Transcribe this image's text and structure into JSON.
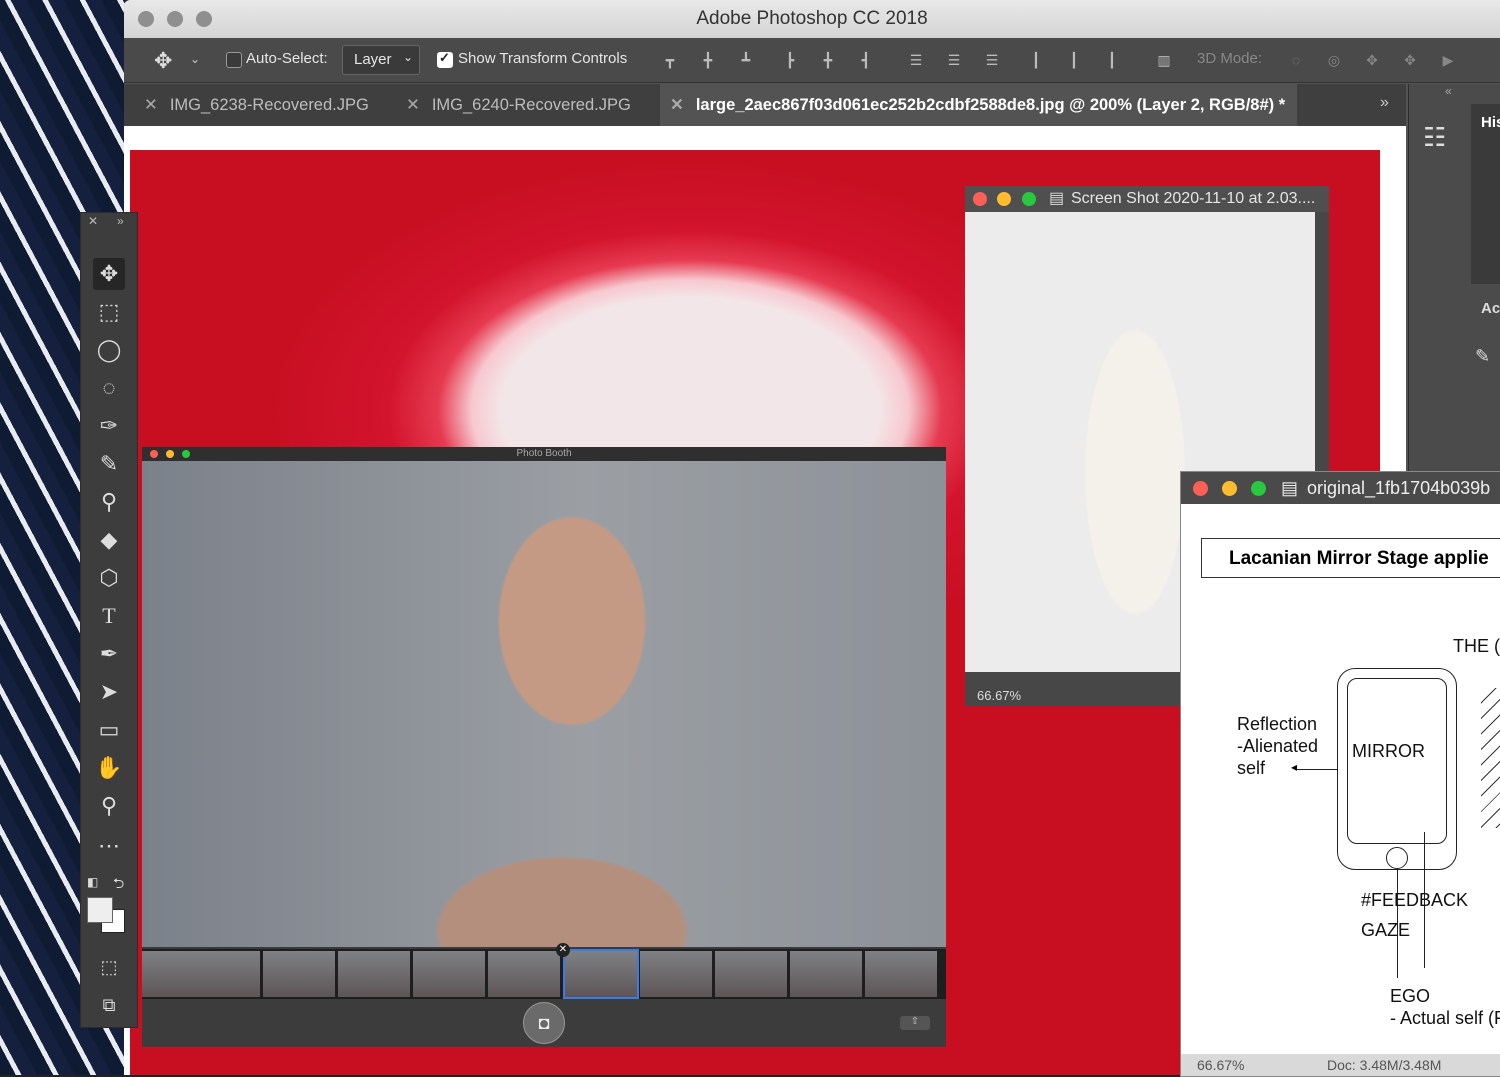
{
  "app": {
    "title": "Adobe Photoshop CC 2018"
  },
  "options_bar": {
    "auto_select_label": "Auto-Select:",
    "auto_select_value": "Layer",
    "show_transform_label": "Show Transform Controls",
    "mode_3d_label": "3D Mode:"
  },
  "tabs": [
    {
      "label": "IMG_6238-Recovered.JPG"
    },
    {
      "label": "IMG_6240-Recovered.JPG"
    },
    {
      "label": "large_2aec867f03d061ec252b2cdbf2588de8.jpg @ 200% (Layer 2, RGB/8#) *"
    }
  ],
  "right_panel": {
    "histogram_label": "His",
    "adjust_label": "Ac"
  },
  "photo_booth": {
    "title": "Photo Booth"
  },
  "figurine_window": {
    "title": "Screen Shot 2020-11-10 at 2.03....",
    "zoom": "66.67%"
  },
  "diagram_window": {
    "title": "original_1fb1704b039b",
    "heading": "Lacanian Mirror Stage applie",
    "label_the": "THE (",
    "reflection_l1": "Reflection",
    "reflection_l2": "-Alienated",
    "reflection_l3": "self",
    "mirror": "MIRROR",
    "feedback": "#FEEDBACK",
    "gaze": "GAZE",
    "ego": "EGO",
    "actual_self": "- Actual self (F",
    "zoom": "66.67%",
    "doc": "Doc: 3.48M/3.48M"
  },
  "colors": {
    "accent": "#3b7be6",
    "panel": "#535353",
    "red": "#d2142c"
  }
}
